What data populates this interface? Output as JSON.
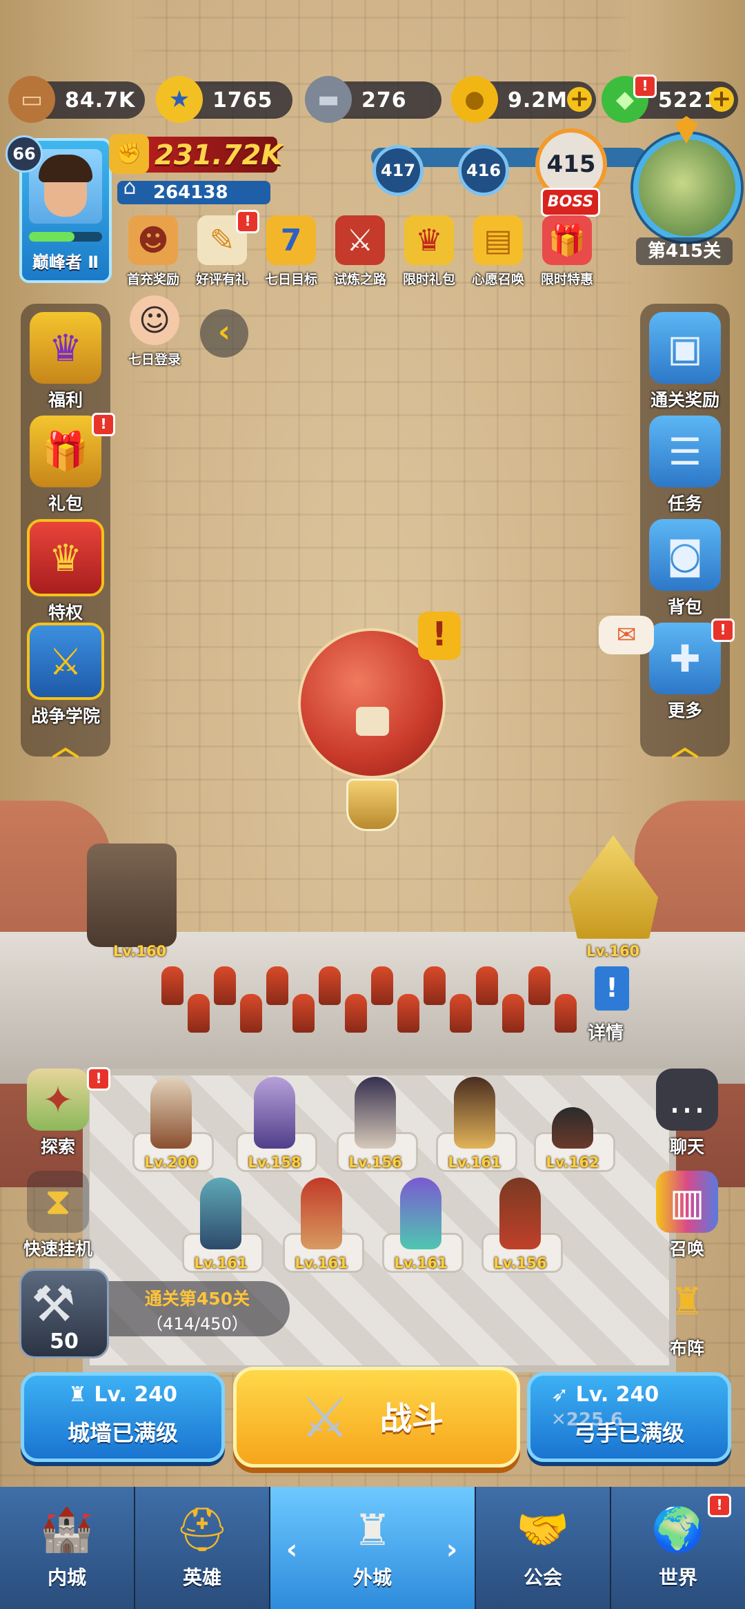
{
  "resources": {
    "wood": "84.7K",
    "medal": "1765",
    "iron": "276",
    "gold": "9.2M",
    "gems": "5221"
  },
  "player": {
    "level": "66",
    "rank": "巅峰者 Ⅱ",
    "power": "231.72K",
    "sub_power": "264138",
    "xp_fraction": 0.62
  },
  "stages": {
    "prev2": "417",
    "prev1": "416",
    "current": "415",
    "boss_tag": "BOSS",
    "stage_label": "第415关"
  },
  "events": [
    {
      "label": "首充奖励",
      "icon": "ogre-icon"
    },
    {
      "label": "好评有礼",
      "icon": "review-clipboard-icon"
    },
    {
      "label": "七日目标",
      "icon": "seven-badge-icon"
    },
    {
      "label": "试炼之路",
      "icon": "crossed-swords-banner-icon"
    },
    {
      "label": "限时礼包",
      "icon": "crown-gift-icon"
    },
    {
      "label": "心愿召唤",
      "icon": "ticket-icon"
    },
    {
      "label": "限时特惠",
      "icon": "gift-box-icon"
    },
    {
      "label": "七日登录",
      "icon": "girl-avatar-icon"
    }
  ],
  "left_menu": [
    {
      "label": "福利",
      "icon": "crown-shield-icon"
    },
    {
      "label": "礼包",
      "icon": "gift-icon"
    },
    {
      "label": "特权",
      "icon": "privilege-crown-icon"
    },
    {
      "label": "战争学院",
      "icon": "crossed-swords-shield-icon"
    }
  ],
  "right_menu": [
    {
      "label": "通关奖励",
      "icon": "reward-box-icon"
    },
    {
      "label": "任务",
      "icon": "task-scroll-icon"
    },
    {
      "label": "背包",
      "icon": "backpack-icon"
    },
    {
      "label": "更多",
      "icon": "plus-cross-icon"
    }
  ],
  "defenses": {
    "left_tower_level": "Lv.160",
    "right_tower_level": "Lv.160",
    "details_label": "详情"
  },
  "heroes_row1": [
    "Lv.200",
    "Lv.158",
    "Lv.156",
    "Lv.161",
    "Lv.162"
  ],
  "heroes_row2": [
    "Lv.161",
    "Lv.161",
    "Lv.161",
    "Lv.156"
  ],
  "side_actions": {
    "explore": "探索",
    "quick_idle": "快速挂机",
    "chat": "聊天",
    "summon": "召唤",
    "formation": "布阵"
  },
  "progress": {
    "hammer_count": "50",
    "clear_title": "通关第450关",
    "clear_progress": "（414/450）"
  },
  "actions": {
    "wall_level": "Lv. 240",
    "wall_status": "城墙已满级",
    "fight": "战斗",
    "archer_level": "Lv. 240",
    "archer_bonus": "225.6",
    "archer_status": "弓手已满级"
  },
  "nav": [
    {
      "label": "内城",
      "icon": "castle-icon"
    },
    {
      "label": "英雄",
      "icon": "helmet-icon"
    },
    {
      "label": "外城",
      "icon": "outer-castle-icon"
    },
    {
      "label": "公会",
      "icon": "handshake-icon"
    },
    {
      "label": "世界",
      "icon": "globe-icon"
    }
  ],
  "colors": {
    "accent_gold": "#f4c21a",
    "badge_red": "#e8332a",
    "button_blue": "#1a74d0",
    "fight_yellow": "#f7a51b"
  }
}
